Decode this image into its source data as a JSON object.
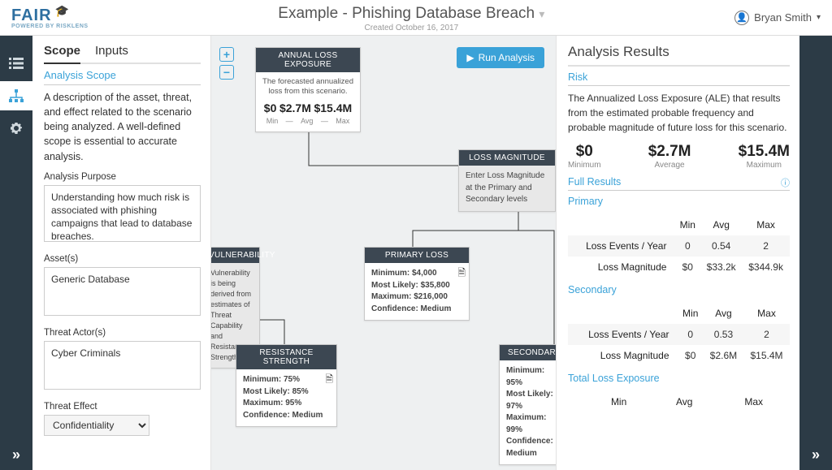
{
  "brand": {
    "name": "FAIR-U",
    "powered": "POWERED BY RISKLENS"
  },
  "header": {
    "title": "Example - Phishing Database Breach",
    "created": "Created October 16, 2017"
  },
  "user": {
    "name": "Bryan Smith"
  },
  "tabs": {
    "scope": "Scope",
    "inputs": "Inputs"
  },
  "scope": {
    "title": "Analysis Scope",
    "desc": "A description of the asset, threat, and effect related to the scenario being analyzed. A well-defined scope is essential to accurate analysis.",
    "purpose_label": "Analysis Purpose",
    "purpose_value": "Understanding how much risk is associated with phishing campaigns that lead to database breaches.",
    "asset_label": "Asset(s)",
    "asset_value": "Generic Database",
    "threat_label": "Threat Actor(s)",
    "threat_value": "Cyber Criminals",
    "effect_label": "Threat Effect",
    "effect_value": "Confidentiality"
  },
  "run_label": "Run Analysis",
  "nodes": {
    "ale": {
      "title": "ANNUAL LOSS EXPOSURE",
      "desc": "The forecasted annualized loss from this scenario.",
      "min": "$0",
      "avg": "$2.7M",
      "max": "$15.4M",
      "min_l": "Min",
      "avg_l": "Avg",
      "max_l": "Max"
    },
    "lm": {
      "title": "LOSS MAGNITUDE",
      "desc": "Enter Loss Magnitude at the Primary and Secondary levels"
    },
    "vuln": {
      "title": "VULNERABILITY",
      "desc": "Vulnerability is being derived from estimates of Threat Capability and Resistance Strength."
    },
    "primary": {
      "title": "PRIMARY LOSS",
      "min": "Minimum: $4,000",
      "ml": "Most Likely: $35,800",
      "max": "Maximum: $216,000",
      "conf": "Confidence: Medium"
    },
    "rs": {
      "title": "RESISTANCE STRENGTH",
      "min": "Minimum: 75%",
      "ml": "Most Likely: 85%",
      "max": "Maximum: 95%",
      "conf": "Confidence: Medium"
    },
    "sec": {
      "title": "SECONDARY",
      "min": "Minimum: 95%",
      "ml": "Most Likely: 97%",
      "max": "Maximum: 99%",
      "conf": "Confidence: Medium"
    }
  },
  "results": {
    "title": "Analysis Results",
    "risk_h": "Risk",
    "risk_desc": "The Annualized Loss Exposure (ALE) that results from the estimated probable frequency and probable magnitude of future loss for this scenario.",
    "summary": {
      "min_v": "$0",
      "min_l": "Minimum",
      "avg_v": "$2.7M",
      "avg_l": "Average",
      "max_v": "$15.4M",
      "max_l": "Maximum"
    },
    "full_h": "Full Results",
    "primary_h": "Primary",
    "cols": {
      "min": "Min",
      "avg": "Avg",
      "max": "Max"
    },
    "p_rows": [
      {
        "name": "Loss Events / Year",
        "min": "0",
        "avg": "0.54",
        "max": "2"
      },
      {
        "name": "Loss Magnitude",
        "min": "$0",
        "avg": "$33.2k",
        "max": "$344.9k"
      }
    ],
    "secondary_h": "Secondary",
    "s_rows": [
      {
        "name": "Loss Events / Year",
        "min": "0",
        "avg": "0.53",
        "max": "2"
      },
      {
        "name": "Loss Magnitude",
        "min": "$0",
        "avg": "$2.6M",
        "max": "$15.4M"
      }
    ],
    "total_h": "Total Loss Exposure"
  },
  "chart_data": {
    "type": "table",
    "title": "Analysis Results — Annualized Loss Exposure",
    "summary": {
      "Minimum": 0,
      "Average": 2700000,
      "Maximum": 15400000
    },
    "primary": [
      {
        "metric": "Loss Events / Year",
        "min": 0,
        "avg": 0.54,
        "max": 2
      },
      {
        "metric": "Loss Magnitude",
        "min": 0,
        "avg": 33200,
        "max": 344900
      }
    ],
    "secondary": [
      {
        "metric": "Loss Events / Year",
        "min": 0,
        "avg": 0.53,
        "max": 2
      },
      {
        "metric": "Loss Magnitude",
        "min": 0,
        "avg": 2600000,
        "max": 15400000
      }
    ],
    "nodes": {
      "primary_loss": {
        "min": 4000,
        "most_likely": 35800,
        "max": 216000,
        "confidence": "Medium"
      },
      "resistance_strength_pct": {
        "min": 75,
        "most_likely": 85,
        "max": 95,
        "confidence": "Medium"
      },
      "secondary_pct": {
        "min": 95,
        "most_likely": 97,
        "max": 99,
        "confidence": "Medium"
      }
    }
  }
}
